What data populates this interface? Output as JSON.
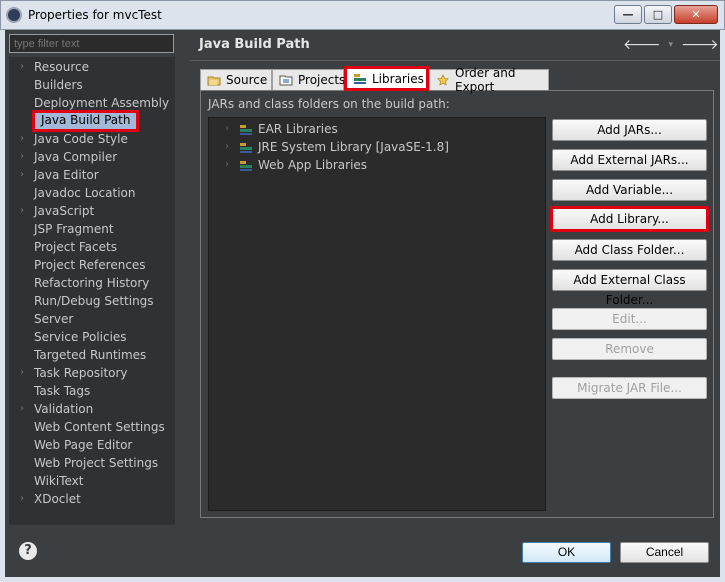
{
  "window": {
    "title": "Properties for mvcTest",
    "controls": [
      "minimize",
      "maximize",
      "close"
    ]
  },
  "nav": {
    "filter_placeholder": "type filter text",
    "items": [
      {
        "label": "Resource",
        "expandable": true
      },
      {
        "label": "Builders",
        "expandable": false
      },
      {
        "label": "Deployment Assembly",
        "expandable": false
      },
      {
        "label": "Java Build Path",
        "expandable": false,
        "selected": true
      },
      {
        "label": "Java Code Style",
        "expandable": true
      },
      {
        "label": "Java Compiler",
        "expandable": true
      },
      {
        "label": "Java Editor",
        "expandable": true
      },
      {
        "label": "Javadoc Location",
        "expandable": false
      },
      {
        "label": "JavaScript",
        "expandable": true
      },
      {
        "label": "JSP Fragment",
        "expandable": false
      },
      {
        "label": "Project Facets",
        "expandable": false
      },
      {
        "label": "Project References",
        "expandable": false
      },
      {
        "label": "Refactoring History",
        "expandable": false
      },
      {
        "label": "Run/Debug Settings",
        "expandable": false
      },
      {
        "label": "Server",
        "expandable": false
      },
      {
        "label": "Service Policies",
        "expandable": false
      },
      {
        "label": "Targeted Runtimes",
        "expandable": false
      },
      {
        "label": "Task Repository",
        "expandable": true
      },
      {
        "label": "Task Tags",
        "expandable": false
      },
      {
        "label": "Validation",
        "expandable": true
      },
      {
        "label": "Web Content Settings",
        "expandable": false
      },
      {
        "label": "Web Page Editor",
        "expandable": false
      },
      {
        "label": "Web Project Settings",
        "expandable": false
      },
      {
        "label": "WikiText",
        "expandable": false
      },
      {
        "label": "XDoclet",
        "expandable": true
      }
    ]
  },
  "main": {
    "title": "Java Build Path",
    "tabs": [
      {
        "label": "Source",
        "icon": "folder-icon"
      },
      {
        "label": "Projects",
        "icon": "project-icon"
      },
      {
        "label": "Libraries",
        "icon": "library-icon",
        "active": true
      },
      {
        "label": "Order and Export",
        "icon": "order-export-icon"
      }
    ],
    "list_label": "JARs and class folders on the build path:",
    "libraries": [
      "EAR Libraries",
      "JRE System Library [JavaSE-1.8]",
      "Web App Libraries"
    ],
    "buttons": {
      "add_jars": "Add JARs...",
      "add_external_jars": "Add External JARs...",
      "add_variable": "Add Variable...",
      "add_library": "Add Library...",
      "add_class_folder": "Add Class Folder...",
      "add_external_class_folder": "Add External Class Folder...",
      "edit": "Edit...",
      "remove": "Remove",
      "migrate_jar": "Migrate JAR File..."
    }
  },
  "footer": {
    "help": "?",
    "ok": "OK",
    "cancel": "Cancel"
  },
  "colors": {
    "highlight": "#e00013",
    "background": "#3c3f41",
    "list_background": "#2b2b2b",
    "selection": "#9fb9d6"
  }
}
